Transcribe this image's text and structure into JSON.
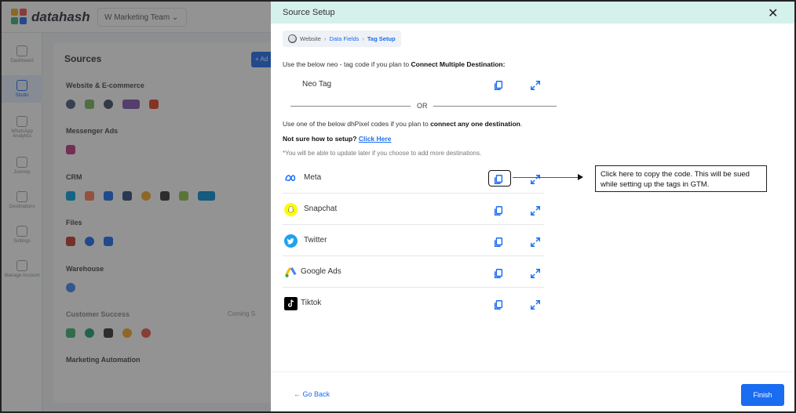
{
  "app": {
    "brand": "datahash",
    "team_selector": "W Marketing Team",
    "sidebar": [
      {
        "label": "Dashboard"
      },
      {
        "label": "Studio"
      },
      {
        "label": "WhatsApp Analytics"
      },
      {
        "label": "Journey"
      },
      {
        "label": "Destinations"
      },
      {
        "label": "Settings"
      },
      {
        "label": "Manage Account"
      }
    ],
    "page_title": "Sources",
    "add_label": "+ Ad",
    "categories": [
      "Website & E-commerce",
      "Messenger Ads",
      "CRM",
      "Files",
      "Warehouse",
      "Customer Success",
      "Marketing Automation"
    ],
    "coming_soon": "Coming S"
  },
  "drawer": {
    "title": "Source Setup",
    "breadcrumb": {
      "website": "Website",
      "data_fields": "Data Fields",
      "tag_setup": "Tag Setup"
    },
    "neo_intro_prefix": "Use the below neo - tag code if you plan to ",
    "neo_intro_bold": "Connect Multiple Destination:",
    "neo_tag_label": "Neo Tag",
    "or_label": "OR",
    "pixel_intro_prefix": "Use one of the below dhPixel codes if you plan to ",
    "pixel_intro_bold": "connect any one destination",
    "pixel_intro_suffix": ".",
    "not_sure": "Not sure how to setup?",
    "click_here": "Click Here",
    "update_note": "*You will be able to update later if you choose to add more destinations.",
    "destinations": [
      {
        "name": "Meta"
      },
      {
        "name": "Snapchat"
      },
      {
        "name": "Twitter"
      },
      {
        "name": "Google Ads"
      },
      {
        "name": "Tiktok"
      }
    ],
    "callout": "Click here to copy the code. This will be sued while setting up the tags in GTM.",
    "go_back": "Go Back",
    "finish": "Finish"
  },
  "colors": {
    "accent": "#1a6cf0",
    "header_bg": "#d5f1ec",
    "snapchat": "#FFFC00",
    "twitter": "#1DA1F2",
    "meta": "#0866FF"
  }
}
